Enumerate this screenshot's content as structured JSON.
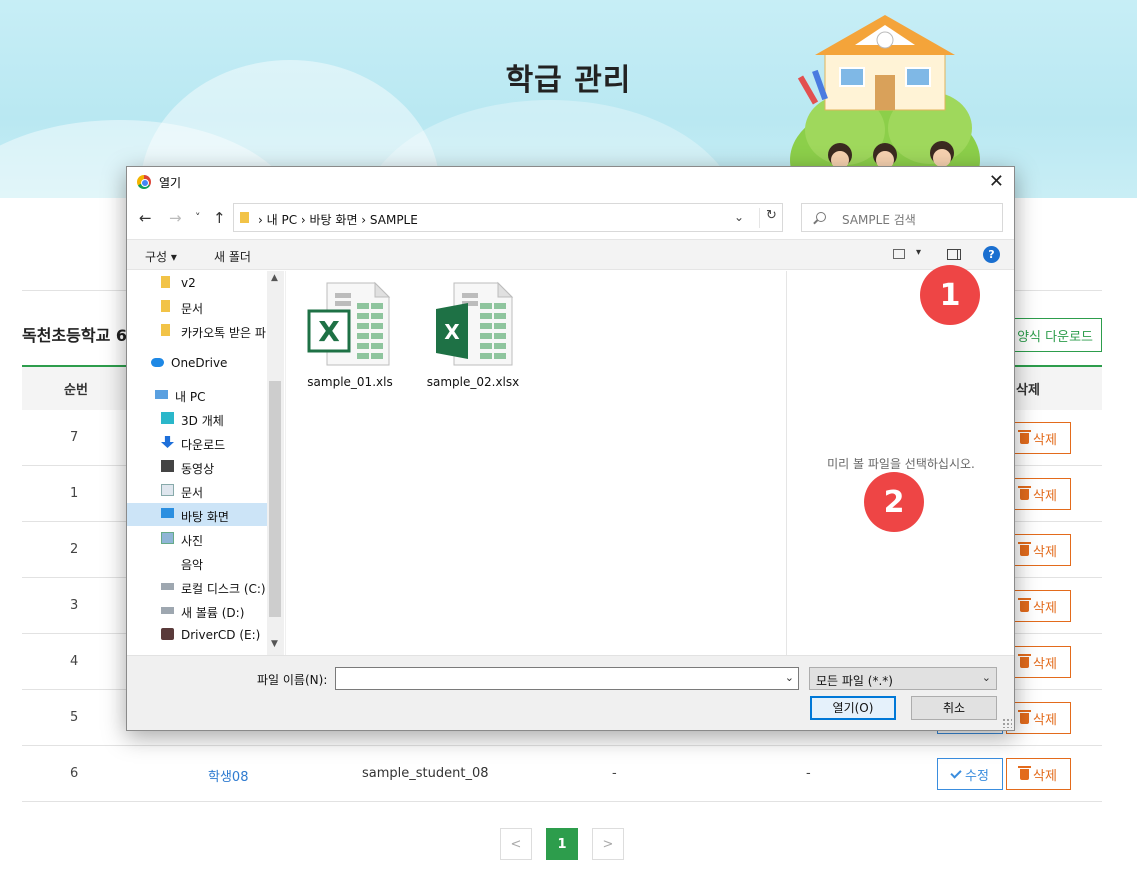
{
  "page": {
    "title": "학급 관리",
    "school_heading": "독천초등학교 6",
    "download_button": "양식 다운로드",
    "table": {
      "headers": {
        "no": "순번",
        "delete": "삭제"
      },
      "rows": [
        {
          "no": "7",
          "name": "",
          "student_id": "",
          "d1": "",
          "d2": ""
        },
        {
          "no": "1",
          "name": "",
          "student_id": "",
          "d1": "",
          "d2": ""
        },
        {
          "no": "2",
          "name": "",
          "student_id": "",
          "d1": "",
          "d2": ""
        },
        {
          "no": "3",
          "name": "",
          "student_id": "",
          "d1": "",
          "d2": ""
        },
        {
          "no": "4",
          "name": "",
          "student_id": "",
          "d1": "",
          "d2": ""
        },
        {
          "no": "5",
          "name": "",
          "student_id": "",
          "d1": "",
          "d2": ""
        },
        {
          "no": "6",
          "name": "학생08",
          "student_id": "sample_student_08",
          "d1": "-",
          "d2": "-"
        }
      ],
      "edit_label": "수정",
      "delete_label": "삭제"
    },
    "pagination": {
      "prev": "<",
      "current": "1",
      "next": ">"
    }
  },
  "dialog": {
    "title": "열기",
    "close": "✕",
    "nav": {
      "back": "←",
      "forward": "→",
      "recent": "˅",
      "up": "↑"
    },
    "address": "›  내 PC  ›  바탕 화면  ›  SAMPLE",
    "address_dropdown": "⌄",
    "refresh": "↻",
    "search_placeholder": "SAMPLE 검색",
    "toolbar": {
      "organize": "구성 ▾",
      "new_folder": "새 폴더",
      "view_caret": "▾",
      "help": "?"
    },
    "sidebar": {
      "scroll_up": "▲",
      "scroll_down": "▼",
      "items": [
        {
          "label": "v2",
          "icon": "folder-icon"
        },
        {
          "label": "문서",
          "icon": "folder-icon"
        },
        {
          "label": "카카오톡 받은 파",
          "icon": "folder-icon"
        },
        {
          "label": "OneDrive",
          "icon": "cloud-icon"
        },
        {
          "label": "내 PC",
          "icon": "computer-icon"
        },
        {
          "label": "3D 개체",
          "icon": "cube-icon"
        },
        {
          "label": "다운로드",
          "icon": "download-icon"
        },
        {
          "label": "동영상",
          "icon": "video-icon"
        },
        {
          "label": "문서",
          "icon": "document-icon"
        },
        {
          "label": "바탕 화면",
          "icon": "desktop-icon",
          "selected": true
        },
        {
          "label": "사진",
          "icon": "picture-icon"
        },
        {
          "label": "음악",
          "icon": "music-icon"
        },
        {
          "label": "로컬 디스크 (C:)",
          "icon": "drive-icon"
        },
        {
          "label": "새 볼륨 (D:)",
          "icon": "drive-icon"
        },
        {
          "label": "DriverCD (E:)",
          "icon": "cd-icon"
        }
      ]
    },
    "files": [
      {
        "name": "sample_01.xls",
        "icon": "excel-legacy-icon"
      },
      {
        "name": "sample_02.xlsx",
        "icon": "excel-icon"
      }
    ],
    "preview_message": "미리 볼 파일을 선택하십시오.",
    "filename_label": "파일 이름(N):",
    "filename_value": "",
    "filename_dropdown": "⌄",
    "filetype": "모든 파일 (*.*)",
    "filetype_dropdown": "⌄",
    "open_button": "열기(O)",
    "cancel_button": "취소"
  },
  "annotations": {
    "badge1": "1",
    "badge2": "2"
  },
  "colors": {
    "accent_green": "#2d9d4c",
    "link_blue": "#2f7bd0",
    "delete_orange": "#e36b1c",
    "badge_red": "#ee4545"
  }
}
